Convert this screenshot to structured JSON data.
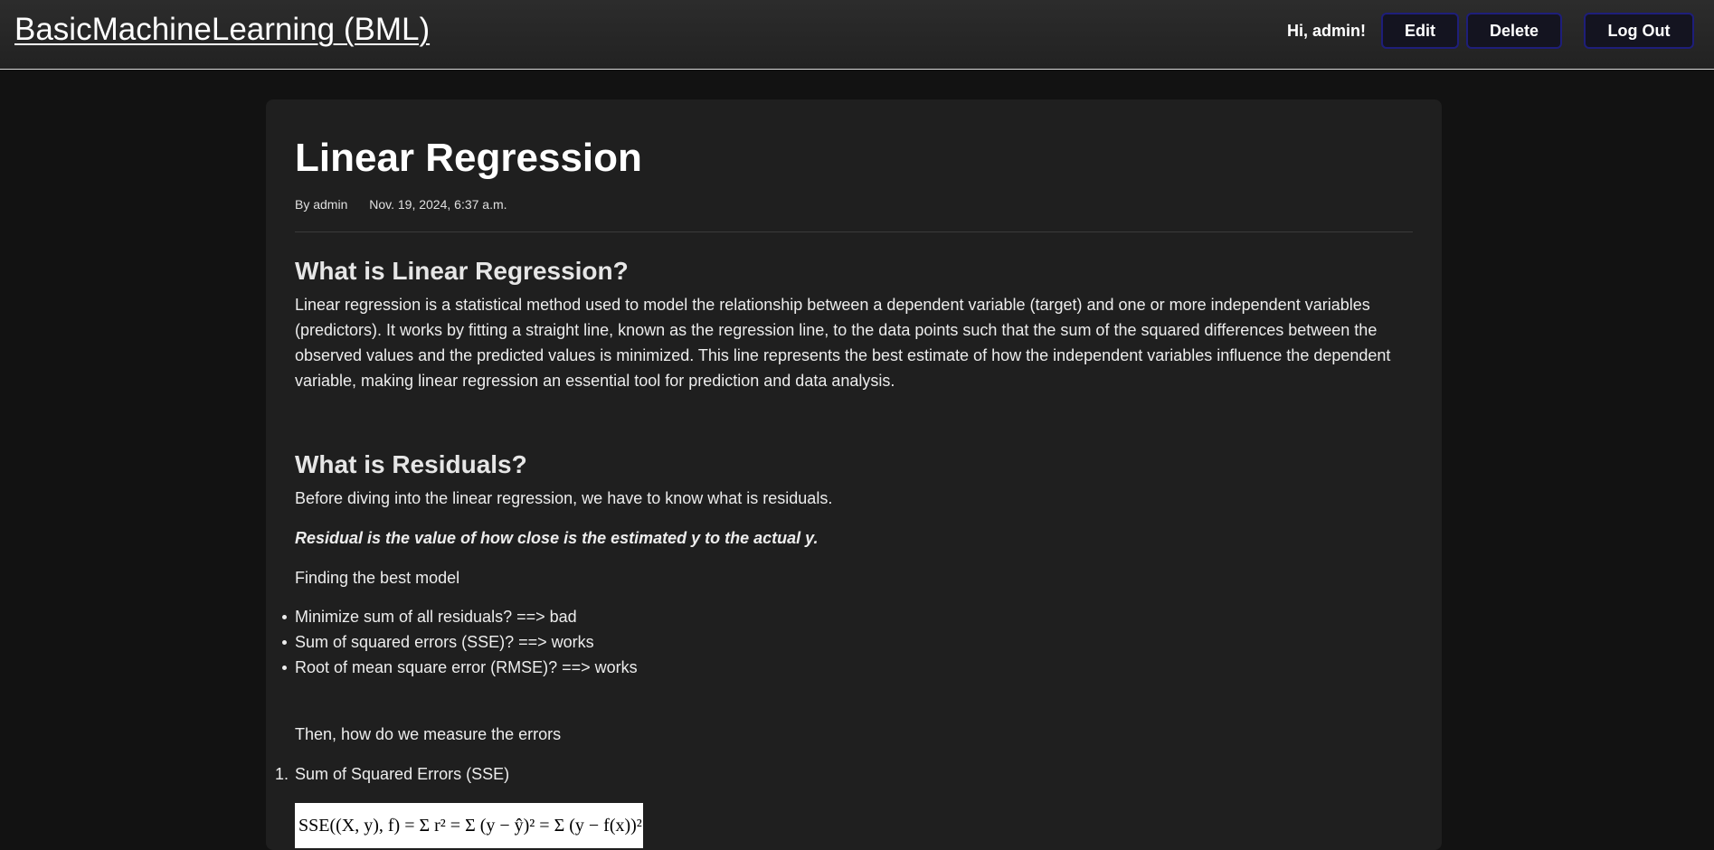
{
  "header": {
    "brand": "BasicMachineLearning (BML)",
    "greeting": "Hi, admin!",
    "edit_label": "Edit",
    "delete_label": "Delete",
    "logout_label": "Log Out"
  },
  "post": {
    "title": "Linear Regression",
    "author": "By admin",
    "date": "Nov. 19, 2024, 6:37 a.m.",
    "section1": {
      "heading": "What is Linear Regression?",
      "body": "Linear regression is a statistical method used to model the relationship between a dependent variable (target) and one or more independent variables (predictors). It works by fitting a straight line, known as the regression line, to the data points such that the sum of the squared differences between the observed values and the predicted values is minimized. This line represents the best estimate of how the independent variables influence the dependent variable, making linear regression an essential tool for prediction and data analysis."
    },
    "section2": {
      "heading": "What is Residuals?",
      "intro": "Before diving into the linear regression, we have to know what is residuals.",
      "emphasis": "Residual is the value of how close is the estimated y to the actual y.",
      "finding": "Finding the best model",
      "bullets": [
        "Minimize sum of all residuals? ==> bad",
        "Sum of squared errors (SSE)? ==> works",
        "Root of mean square error (RMSE)? ==> works"
      ],
      "measure": "Then, how do we measure the errors",
      "numbered": [
        {
          "marker": "1.",
          "label": "Sum of Squared Errors (SSE)"
        }
      ],
      "formula": "SSE((X, y), f) = Σ r² = Σ (y − ŷ)² = Σ (y − f(x))²"
    }
  }
}
